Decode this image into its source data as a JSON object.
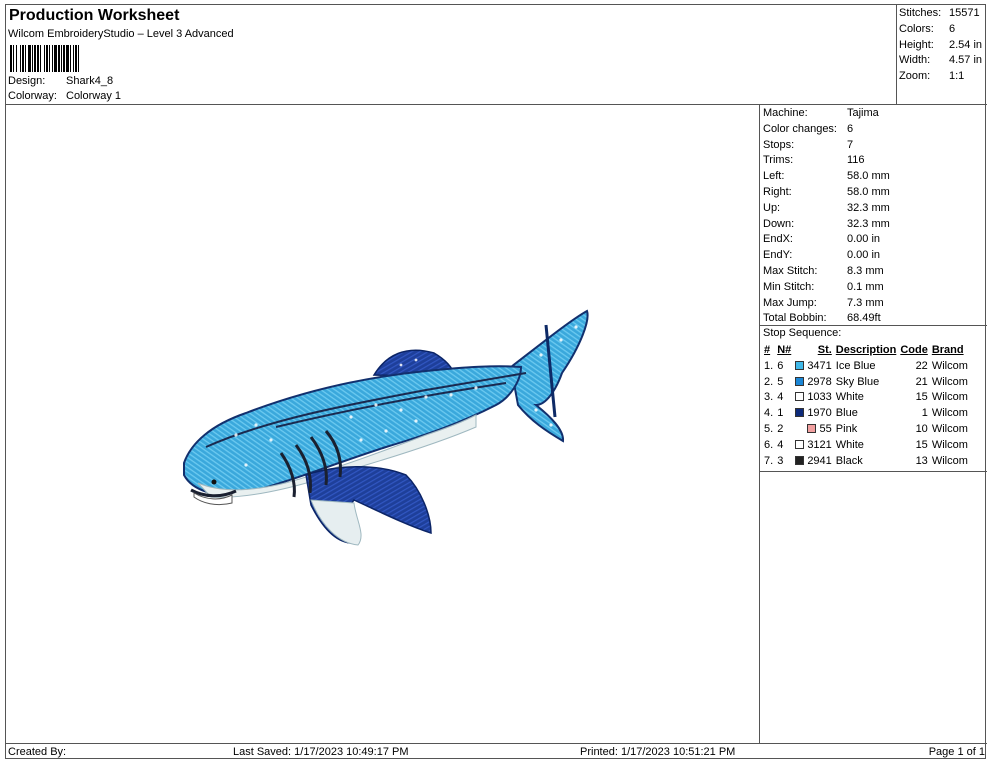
{
  "header": {
    "title": "Production Worksheet",
    "software": "Wilcom EmbroideryStudio – Level 3 Advanced",
    "design_label": "Design:",
    "design_value": "Shark4_8",
    "colorway_label": "Colorway:",
    "colorway_value": "Colorway 1"
  },
  "summary": {
    "stitches_label": "Stitches:",
    "stitches_value": "15571",
    "colors_label": "Colors:",
    "colors_value": "6",
    "height_label": "Height:",
    "height_value": "2.54 in",
    "width_label": "Width:",
    "width_value": "4.57 in",
    "zoom_label": "Zoom:",
    "zoom_value": "1:1"
  },
  "machine_info": [
    {
      "label": "Machine:",
      "value": "Tajima"
    },
    {
      "label": "Color changes:",
      "value": "6"
    },
    {
      "label": "Stops:",
      "value": "7"
    },
    {
      "label": "Trims:",
      "value": "116"
    },
    {
      "label": "Left:",
      "value": "58.0 mm"
    },
    {
      "label": "Right:",
      "value": "58.0 mm"
    },
    {
      "label": "Up:",
      "value": "32.3 mm"
    },
    {
      "label": "Down:",
      "value": "32.3 mm"
    },
    {
      "label": "EndX:",
      "value": "0.00 in"
    },
    {
      "label": "EndY:",
      "value": "0.00 in"
    },
    {
      "label": "Max Stitch:",
      "value": "8.3 mm"
    },
    {
      "label": "Min Stitch:",
      "value": "0.1 mm"
    },
    {
      "label": "Max Jump:",
      "value": "7.3 mm"
    },
    {
      "label": "Total Bobbin:",
      "value": "68.49ft"
    }
  ],
  "stop_sequence": {
    "title": "Stop Sequence:",
    "columns": {
      "num": "#",
      "n": "N#",
      "st": "St.",
      "description": "Description",
      "code": "Code",
      "brand": "Brand"
    },
    "rows": [
      {
        "num": "1.",
        "n": "6",
        "color": "#3fb8e8",
        "st": "3471",
        "description": "Ice Blue",
        "code": "22",
        "brand": "Wilcom"
      },
      {
        "num": "2.",
        "n": "5",
        "color": "#1a86d6",
        "st": "2978",
        "description": "Sky Blue",
        "code": "21",
        "brand": "Wilcom"
      },
      {
        "num": "3.",
        "n": "4",
        "color": "#ffffff",
        "st": "1033",
        "description": "White",
        "code": "15",
        "brand": "Wilcom"
      },
      {
        "num": "4.",
        "n": "1",
        "color": "#0d2a7a",
        "st": "1970",
        "description": "Blue",
        "code": "1",
        "brand": "Wilcom"
      },
      {
        "num": "5.",
        "n": "2",
        "color": "#f2a0a0",
        "st": "55",
        "description": "Pink",
        "code": "10",
        "brand": "Wilcom"
      },
      {
        "num": "6.",
        "n": "4",
        "color": "#ffffff",
        "st": "3121",
        "description": "White",
        "code": "15",
        "brand": "Wilcom"
      },
      {
        "num": "7.",
        "n": "3",
        "color": "#222222",
        "st": "2941",
        "description": "Black",
        "code": "13",
        "brand": "Wilcom"
      }
    ]
  },
  "footer": {
    "created_by": "Created By:",
    "last_saved": "Last Saved: 1/17/2023 10:49:17 PM",
    "printed": "Printed: 1/17/2023 10:51:21 PM",
    "page": "Page 1 of 1"
  }
}
